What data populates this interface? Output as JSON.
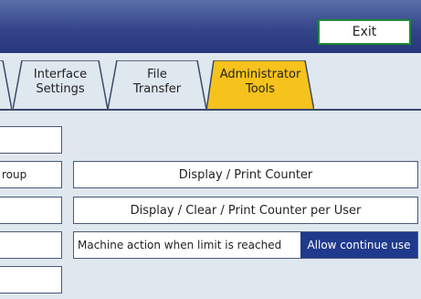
{
  "header": {
    "exit_label": "Exit"
  },
  "tabs": [
    {
      "label": "Interface\nSettings",
      "active": false
    },
    {
      "label": "File\nTransfer",
      "active": false
    },
    {
      "label": "Administrator\nTools",
      "active": true
    }
  ],
  "left_buttons": [
    {
      "label": ""
    },
    {
      "label": "roup"
    },
    {
      "label": ""
    },
    {
      "label": ""
    },
    {
      "label": ""
    }
  ],
  "main": {
    "display_print_counter": "Display / Print Counter",
    "display_clear_print_counter_per_user": "Display / Clear / Print Counter per User",
    "limit_action_label": "Machine action when limit is reached",
    "limit_action_value": "Allow continue use"
  },
  "colors": {
    "header_bg": "#34458a",
    "active_tab": "#f6c21c",
    "exit_border": "#1f8a3a",
    "selected_value_bg": "#1f3a8c"
  }
}
